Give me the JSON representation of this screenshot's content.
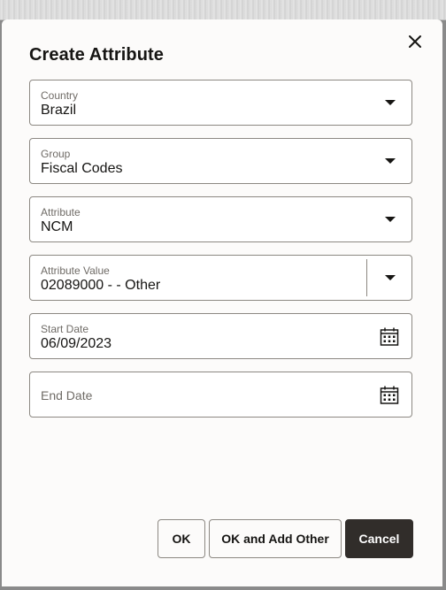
{
  "dialog": {
    "title": "Create Attribute",
    "close_icon": "close-icon"
  },
  "fields": {
    "country": {
      "label": "Country",
      "value": "Brazil",
      "icon": "chevron-down-icon"
    },
    "group": {
      "label": "Group",
      "value": "Fiscal Codes",
      "icon": "chevron-down-icon"
    },
    "attribute": {
      "label": "Attribute",
      "value": "NCM",
      "icon": "chevron-down-icon"
    },
    "attribute_value": {
      "label": "Attribute Value",
      "value": "02089000 - - Other",
      "icon": "chevron-down-icon"
    },
    "start_date": {
      "label": "Start Date",
      "value": "06/09/2023",
      "icon": "calendar-icon"
    },
    "end_date": {
      "label": "End Date",
      "value": "",
      "icon": "calendar-icon"
    }
  },
  "buttons": {
    "ok": "OK",
    "ok_add_other": "OK and Add Other",
    "cancel": "Cancel"
  },
  "colors": {
    "primary_button": "#312d2a",
    "border": "#8c8882",
    "label": "#6f6b66",
    "text": "#161513"
  }
}
